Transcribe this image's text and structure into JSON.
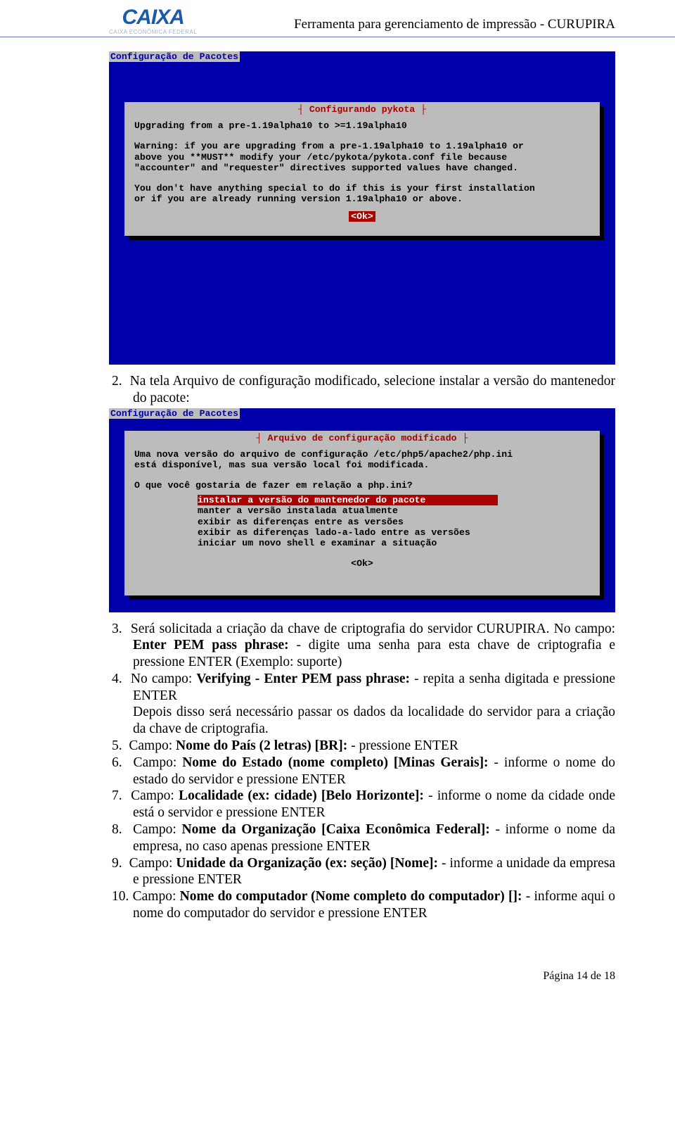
{
  "header": {
    "logo_main": "CAIXA",
    "logo_sub": "CAIXA ECONÔMICA FEDERAL",
    "title": "Ferramenta para gerenciamento de impressão - CURUPIRA"
  },
  "term1": {
    "window_title": "Configuração de Pacotes",
    "dialog_title": "Configurando pykota",
    "line1": "Upgrading from a pre-1.19alpha10 to >=1.19alpha10",
    "warn1": "Warning: if you are upgrading from a pre-1.19alpha10 to 1.19alpha10 or",
    "warn2": "above you **MUST** modify your /etc/pykota/pykota.conf file because",
    "warn3": "\"accounter\" and \"requester\" directives supported values have changed.",
    "info1": "You don't have anything special to do if this is your first installation",
    "info2": "or if you are already running version 1.19alpha10 or above.",
    "ok": "<Ok>"
  },
  "step2": {
    "num": "2.",
    "text": "Na tela Arquivo de configuração modificado, selecione instalar a versão do mantenedor do pacote:"
  },
  "term2": {
    "window_title": "Configuração de Pacotes",
    "dialog_title": "Arquivo de configuração modificado",
    "l1": "Uma nova versão do arquivo de configuração /etc/php5/apache2/php.ini",
    "l2": "está disponível, mas sua versão local foi modificada.",
    "q": "O que você gostaria de fazer em relação a php.ini?",
    "m1": "instalar a versão do mantenedor do pacote             ",
    "m2": "manter a versão instalada atualmente",
    "m3": "exibir as diferenças entre as versões",
    "m4": "exibir as diferenças lado-a-lado entre as versões",
    "m5": "iniciar um novo shell e examinar a situação",
    "ok": "<Ok>"
  },
  "steps": {
    "s3n": "3.",
    "s3a": "Será solicitada a criação da chave de criptografia do servidor CURUPIRA. No campo: ",
    "s3b": "Enter PEM pass phrase:",
    "s3c": " - digite uma senha para esta chave de criptografia e pressione ENTER (Exemplo: suporte)",
    "s4n": "4.",
    "s4a": "No campo: ",
    "s4b": "Verifying - Enter PEM pass phrase:",
    "s4c": " - repita a senha digitada e pressione ENTER",
    "s4d": "Depois disso será necessário passar os dados da localidade do servidor para a criação da chave de criptografia.",
    "s5n": "5.",
    "s5a": "Campo: ",
    "s5b": "Nome do País (2 letras) [BR]:",
    "s5c": " - pressione ENTER",
    "s6n": "6.",
    "s6a": "Campo: ",
    "s6b": "Nome do Estado (nome completo) [Minas Gerais]:",
    "s6c": " - informe o nome do estado do servidor e pressione ENTER",
    "s7n": "7.",
    "s7a": "Campo: ",
    "s7b": "Localidade (ex: cidade) [Belo Horizonte]:",
    "s7c": " - informe o nome da cidade onde está o servidor e pressione ENTER",
    "s8n": "8.",
    "s8a": "Campo: ",
    "s8b": "Nome da Organização [Caixa Econômica Federal]:",
    "s8c": " - informe o nome da empresa, no caso apenas pressione ENTER",
    "s9n": "9.",
    "s9a": "Campo: ",
    "s9b": "Unidade da Organização (ex: seção) [Nome]:",
    "s9c": " - informe a unidade da empresa e pressione ENTER",
    "s10n": "10.",
    "s10a": "Campo: ",
    "s10b": "Nome do computador (Nome completo do computador) []:",
    "s10c": " - informe aqui o nome do computador do servidor e pressione ENTER"
  },
  "footer": "Página 14 de 18"
}
